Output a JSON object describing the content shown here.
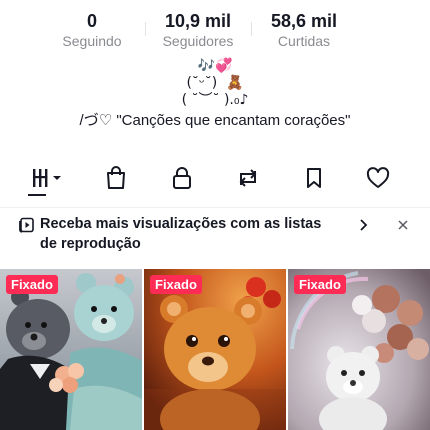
{
  "stats": [
    {
      "value": "0",
      "label": "Seguindo"
    },
    {
      "value": "10,9 mil",
      "label": "Seguidores"
    },
    {
      "value": "58,6 mil",
      "label": "Curtidas"
    }
  ],
  "bio": {
    "line1": "🎶💞",
    "line2": "(˘ᵕ˘)  🧸",
    "line3": "( ˘︶˘ ).₀♪",
    "line4": "/づ♡    \"Canções que encantam corações\""
  },
  "tabs": [
    {
      "name": "videos",
      "icon": "grid-icon"
    },
    {
      "name": "shop",
      "icon": "shopping-bag-icon"
    },
    {
      "name": "private",
      "icon": "lock-icon"
    },
    {
      "name": "reposts",
      "icon": "repost-icon"
    },
    {
      "name": "favorites",
      "icon": "bookmark-icon"
    },
    {
      "name": "liked",
      "icon": "heart-icon"
    }
  ],
  "banner": {
    "text": "Receba mais visualizações com as listas de reprodução",
    "icon": "playlist-icon"
  },
  "videos": [
    {
      "badge": "Fixado"
    },
    {
      "badge": "Fixado"
    },
    {
      "badge": "Fixado"
    }
  ],
  "colors": {
    "badge": "#fe2c55",
    "text_primary": "#161823",
    "text_secondary": "#8a8b91"
  }
}
